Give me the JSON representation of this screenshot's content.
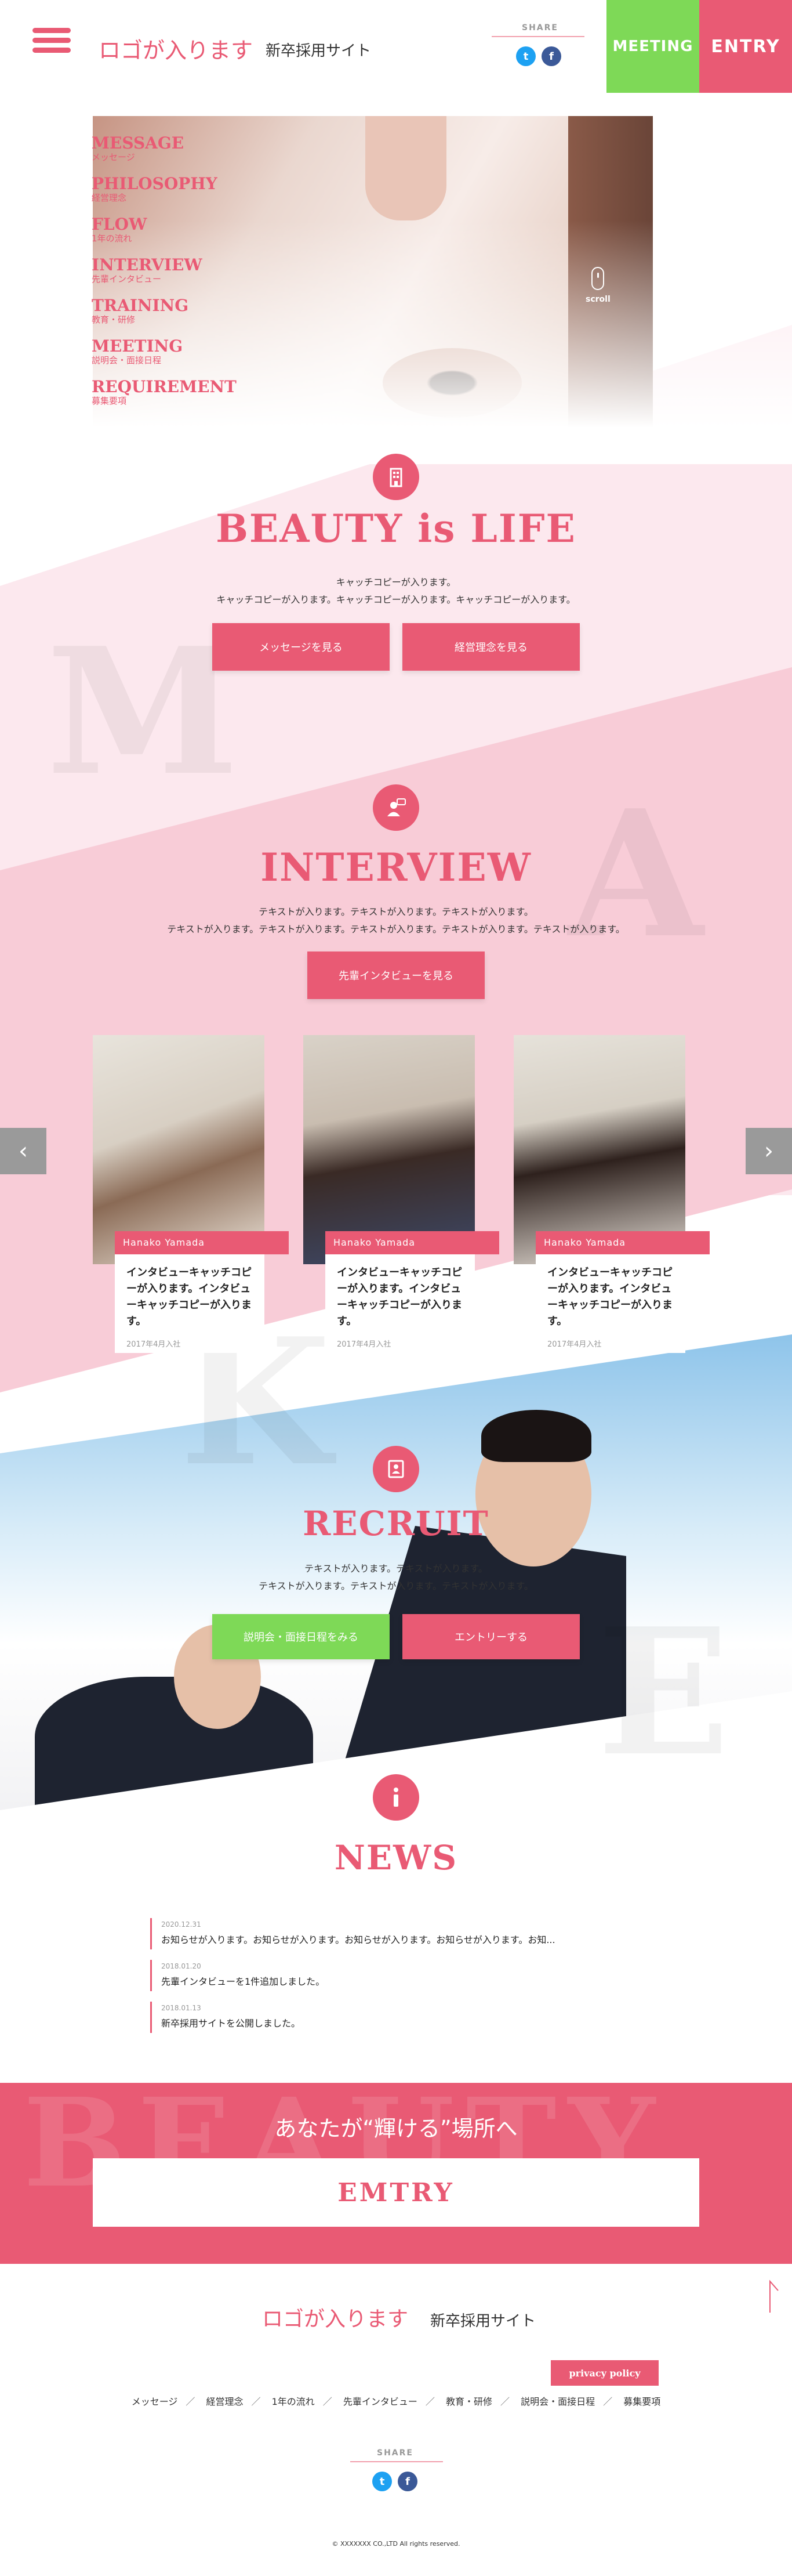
{
  "header": {
    "logo": "ロゴが入ります",
    "site_name": "新卒採用サイト",
    "share_label": "SHARE",
    "twitter_icon": "t",
    "facebook_icon": "f",
    "meeting_label": "MEETING",
    "entry_label": "ENTRY"
  },
  "nav": [
    {
      "en": "MESSAGE",
      "ja": "メッセージ"
    },
    {
      "en": "PHILOSOPHY",
      "ja": "経営理念"
    },
    {
      "en": "FLOW",
      "ja": "1年の流れ"
    },
    {
      "en": "INTERVIEW",
      "ja": "先輩インタビュー"
    },
    {
      "en": "TRAINING",
      "ja": "教育・研修"
    },
    {
      "en": "MEETING",
      "ja": "説明会・面接日程"
    },
    {
      "en": "REQUIREMENT",
      "ja": "募集要項"
    }
  ],
  "hero": {
    "scroll_label": "scroll"
  },
  "beauty": {
    "title": "BEAUTY is LIFE",
    "line1": "キャッチコピーが入ります。",
    "line2": "キャッチコピーが入ります。キャッチコピーが入ります。キャッチコピーが入ります。",
    "btn_message": "メッセージを見る",
    "btn_philosophy": "経営理念を見る"
  },
  "bg_letters": {
    "m": "M",
    "a": "A",
    "k": "K",
    "e": "E"
  },
  "interview": {
    "title": "INTERVIEW",
    "line1": "テキストが入ります。テキストが入ります。テキストが入ります。",
    "line2": "テキストが入ります。テキストが入ります。テキストが入ります。テキストが入ります。テキストが入ります。",
    "btn": "先輩インタビューを見る",
    "prev": "‹",
    "next": "›",
    "cards": [
      {
        "name": "Hanako Yamada",
        "copy": "インタビューキャッチコピーが入ります。インタビューキャッチコピーが入ります。",
        "date": "2017年4月入社"
      },
      {
        "name": "Hanako Yamada",
        "copy": "インタビューキャッチコピーが入ります。インタビューキャッチコピーが入ります。",
        "date": "2017年4月入社"
      },
      {
        "name": "Hanako Yamada",
        "copy": "インタビューキャッチコピーが入ります。インタビューキャッチコピーが入ります。",
        "date": "2017年4月入社"
      }
    ]
  },
  "recruit": {
    "title": "RECRUIT",
    "line1": "テキストが入ります。テキストが入ります。",
    "line2": "テキストが入ります。テキストが入ります。テキストが入ります。",
    "btn_meeting": "説明会・面接日程をみる",
    "btn_entry": "エントリーする"
  },
  "news": {
    "title": "NEWS",
    "items": [
      {
        "date": "2020.12.31",
        "text": "お知らせが入ります。お知らせが入ります。お知らせが入ります。お知らせが入ります。お知..."
      },
      {
        "date": "2018.01.20",
        "text": "先輩インタビューを1件追加しました。"
      },
      {
        "date": "2018.01.13",
        "text": "新卒採用サイトを公開しました。"
      }
    ]
  },
  "entry_band": {
    "bg_text": "BEAUTY",
    "copy": "あなたが“輝ける”場所へ",
    "button": "EMTRY"
  },
  "footer": {
    "logo": "ロゴが入ります",
    "site_name": "新卒採用サイト",
    "privacy": "privacy policy",
    "links": [
      "メッセージ",
      "経営理念",
      "1年の流れ",
      "先輩インタビュー",
      "教育・研修",
      "説明会・面接日程",
      "募集要項"
    ],
    "link_separator": "／",
    "share_label": "SHARE",
    "copyright": "© XXXXXXX CO.,LTD All rights reserved."
  },
  "colors": {
    "accent": "#e95a74",
    "meeting": "#7ed957",
    "light_pink": "#fce8ee",
    "mid_pink": "#f8ccd7"
  }
}
